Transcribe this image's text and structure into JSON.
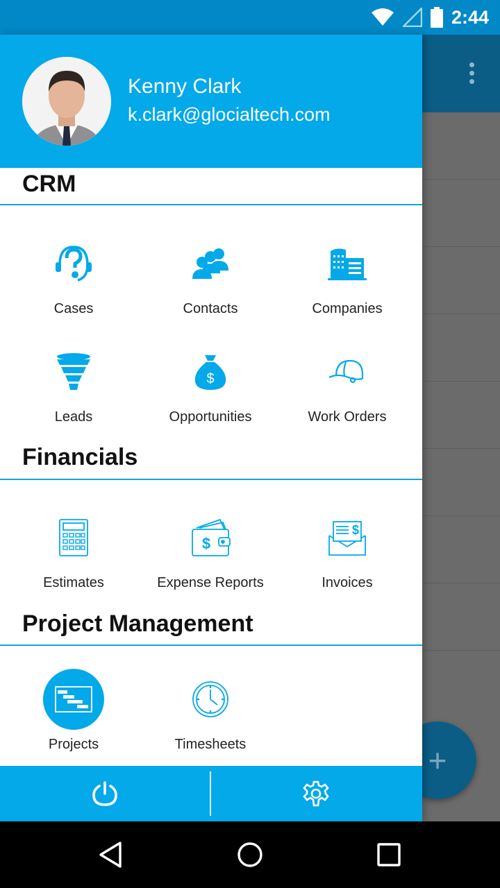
{
  "status_bar": {
    "time": "2:44",
    "icons": [
      "wifi-icon",
      "signal-icon",
      "battery-icon"
    ]
  },
  "user": {
    "name": "Kenny Clark",
    "email": "k.clark@glocialtech.com"
  },
  "sections": {
    "crm": {
      "title": "CRM",
      "items": [
        {
          "label": "Cases",
          "icon": "headset-question-icon"
        },
        {
          "label": "Contacts",
          "icon": "people-group-icon"
        },
        {
          "label": "Companies",
          "icon": "buildings-icon"
        },
        {
          "label": "Leads",
          "icon": "funnel-icon"
        },
        {
          "label": "Opportunities",
          "icon": "money-bag-icon"
        },
        {
          "label": "Work Orders",
          "icon": "hard-hat-icon"
        }
      ]
    },
    "financials": {
      "title": "Financials",
      "items": [
        {
          "label": "Estimates",
          "icon": "calculator-icon"
        },
        {
          "label": "Expense Reports",
          "icon": "wallet-icon"
        },
        {
          "label": "Invoices",
          "icon": "invoice-envelope-icon"
        }
      ]
    },
    "project_management": {
      "title": "Project Management",
      "items": [
        {
          "label": "Projects",
          "icon": "gantt-chart-icon",
          "selected": true
        },
        {
          "label": "Timesheets",
          "icon": "clock-icon"
        }
      ]
    }
  },
  "footer": {
    "left_icon": "power-icon",
    "right_icon": "gear-icon"
  },
  "nav_bar": {
    "buttons": [
      "back-icon",
      "home-icon",
      "recents-icon"
    ]
  },
  "colors": {
    "accent": "#03a9e8",
    "status_bar": "#0288c7",
    "background_toolbar": "#0b5d86",
    "section_rule": "#14a3de"
  }
}
